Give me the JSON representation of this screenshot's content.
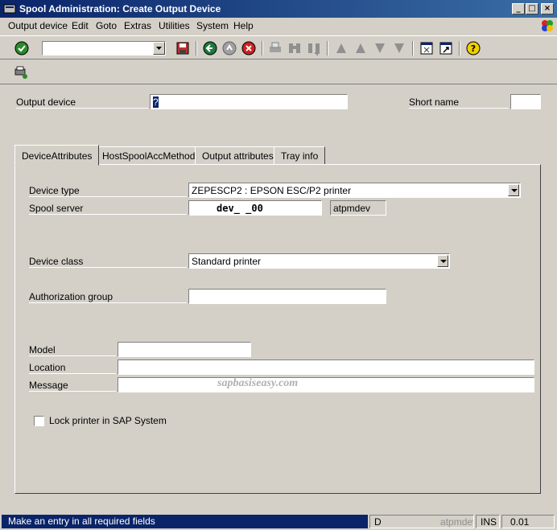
{
  "window": {
    "title": "Spool Administration: Create Output Device"
  },
  "menu": {
    "items": [
      "Output device",
      "Edit",
      "Goto",
      "Extras",
      "Utilities",
      "System",
      "Help"
    ]
  },
  "header": {
    "output_device_label": "Output device",
    "output_device_value": "?",
    "short_name_label": "Short name",
    "short_name_value": ""
  },
  "tabs": [
    "DeviceAttributes",
    "HostSpoolAccMethod",
    "Output attributes",
    "Tray info"
  ],
  "active_tab": "DeviceAttributes",
  "device": {
    "device_type_label": "Device type",
    "device_type_value": "ZEPESCP2 : EPSON ESC/P2 printer",
    "spool_server_label": "Spool server",
    "spool_server_value": "dev_    _00",
    "spool_server_host": "atpmdev",
    "device_class_label": "Device class",
    "device_class_value": "Standard printer",
    "auth_group_label": "Authorization group",
    "auth_group_value": "",
    "model_label": "Model",
    "model_value": "",
    "location_label": "Location",
    "location_value": "",
    "message_label": "Message",
    "message_value": "",
    "lock_label": "Lock printer in SAP System",
    "lock_checked": false
  },
  "watermark": "sapbasiseasy.com",
  "status": {
    "message": "Make an entry in all required fields",
    "system": "D",
    "client": "atpmdev",
    "mode": "INS",
    "time": "0.01"
  },
  "colors": {
    "titlebar": "#0a246a",
    "background": "#d4d0c8",
    "status_message": "#0a246a"
  }
}
